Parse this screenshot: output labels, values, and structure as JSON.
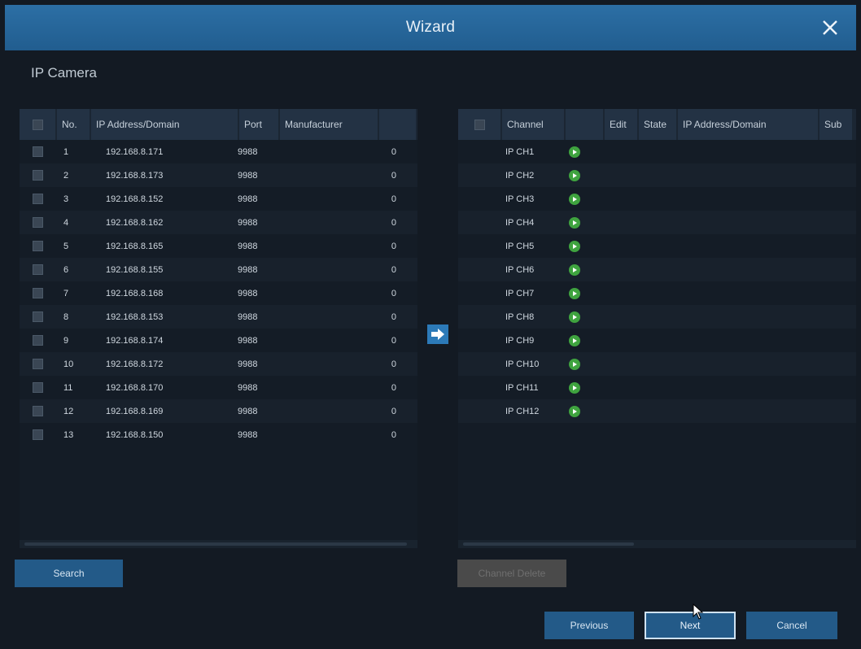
{
  "window": {
    "title": "Wizard"
  },
  "section_title": "IP Camera",
  "left_table": {
    "headers": [
      "",
      "No.",
      "IP Address/Domain",
      "Port",
      "Manufacturer",
      ""
    ],
    "rows": [
      {
        "no": "1",
        "ip": "192.168.8.171",
        "port": "9988",
        "extra": "0"
      },
      {
        "no": "2",
        "ip": "192.168.8.173",
        "port": "9988",
        "extra": "0"
      },
      {
        "no": "3",
        "ip": "192.168.8.152",
        "port": "9988",
        "extra": "0"
      },
      {
        "no": "4",
        "ip": "192.168.8.162",
        "port": "9988",
        "extra": "0"
      },
      {
        "no": "5",
        "ip": "192.168.8.165",
        "port": "9988",
        "extra": "0"
      },
      {
        "no": "6",
        "ip": "192.168.8.155",
        "port": "9988",
        "extra": "0"
      },
      {
        "no": "7",
        "ip": "192.168.8.168",
        "port": "9988",
        "extra": "0"
      },
      {
        "no": "8",
        "ip": "192.168.8.153",
        "port": "9988",
        "extra": "0"
      },
      {
        "no": "9",
        "ip": "192.168.8.174",
        "port": "9988",
        "extra": "0"
      },
      {
        "no": "10",
        "ip": "192.168.8.172",
        "port": "9988",
        "extra": "0"
      },
      {
        "no": "11",
        "ip": "192.168.8.170",
        "port": "9988",
        "extra": "0"
      },
      {
        "no": "12",
        "ip": "192.168.8.169",
        "port": "9988",
        "extra": "0"
      },
      {
        "no": "13",
        "ip": "192.168.8.150",
        "port": "9988",
        "extra": "0"
      }
    ]
  },
  "right_table": {
    "headers": [
      "",
      "Channel",
      "",
      "Edit",
      "State",
      "IP Address/Domain",
      "Sub"
    ],
    "rows": [
      {
        "channel": "IP CH1"
      },
      {
        "channel": "IP CH2"
      },
      {
        "channel": "IP CH3"
      },
      {
        "channel": "IP CH4"
      },
      {
        "channel": "IP CH5"
      },
      {
        "channel": "IP CH6"
      },
      {
        "channel": "IP CH7"
      },
      {
        "channel": "IP CH8"
      },
      {
        "channel": "IP CH9"
      },
      {
        "channel": "IP CH10"
      },
      {
        "channel": "IP CH11"
      },
      {
        "channel": "IP CH12"
      }
    ]
  },
  "buttons": {
    "search": "Search",
    "channel_delete": "Channel Delete",
    "previous": "Previous",
    "next": "Next",
    "cancel": "Cancel"
  },
  "icons": {
    "close": "close-icon",
    "add_arrow": "arrow-right-icon",
    "state": "play-icon",
    "cursor": "mouse-pointer-icon"
  },
  "colors": {
    "title_bar": "#215d8f",
    "button": "#235a88",
    "state_ok": "#3fa33f",
    "arrow_button": "#2c7ab8"
  }
}
